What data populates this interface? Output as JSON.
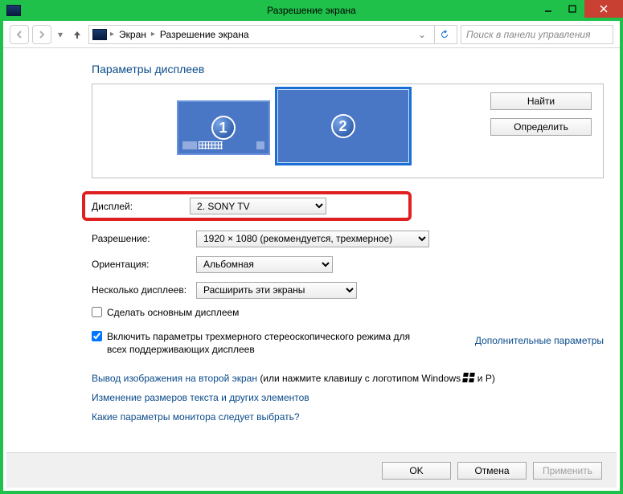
{
  "window": {
    "title": "Разрешение экрана"
  },
  "breadcrumb": {
    "seg1": "Экран",
    "seg2": "Разрешение экрана"
  },
  "search": {
    "placeholder": "Поиск в панели управления"
  },
  "section_title": "Параметры дисплеев",
  "monitors": {
    "m1": "1",
    "m2": "2"
  },
  "preview_buttons": {
    "find": "Найти",
    "identify": "Определить"
  },
  "form": {
    "display_label": "Дисплей:",
    "display_value": "2. SONY TV",
    "resolution_label": "Разрешение:",
    "resolution_value": "1920 × 1080 (рекомендуется, трехмерное)",
    "orientation_label": "Ориентация:",
    "orientation_value": "Альбомная",
    "multi_label": "Несколько дисплеев:",
    "multi_value": "Расширить эти экраны"
  },
  "checks": {
    "make_primary": "Сделать основным дисплеем",
    "stereo3d": "Включить параметры трехмерного стереоскопического режима для всех поддерживающих дисплеев"
  },
  "links": {
    "advanced": "Дополнительные параметры",
    "project_prefix": "Вывод изображения на второй экран",
    "project_suffix": " (или нажмите клавишу с логотипом Windows ",
    "project_suffix2": " и P)",
    "text_size": "Изменение размеров текста и других элементов",
    "which_settings": "Какие параметры монитора следует выбрать?"
  },
  "footer": {
    "ok": "OK",
    "cancel": "Отмена",
    "apply": "Применить"
  }
}
